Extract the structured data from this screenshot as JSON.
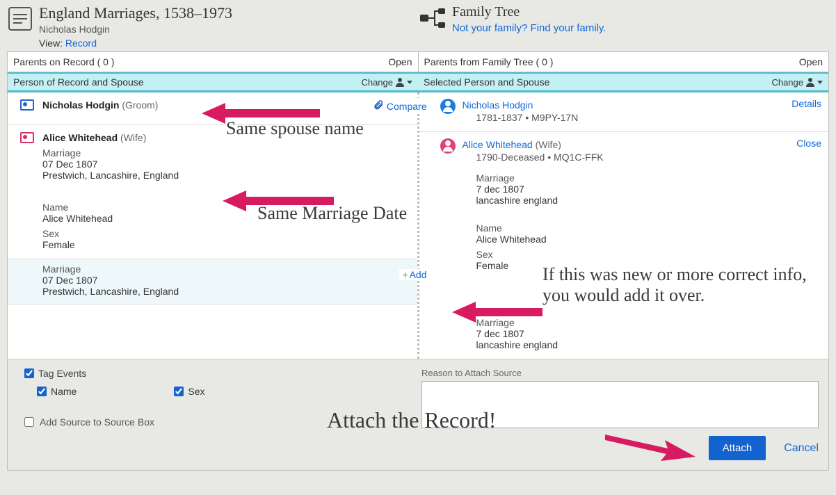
{
  "header": {
    "record_title": "England Marriages, 1538–1973",
    "record_person": "Nicholas Hodgin",
    "view_label": "View:",
    "view_link": "Record",
    "tree_title": "Family Tree",
    "tree_sub": "Not your family? Find your family."
  },
  "parents": {
    "left_label": "Parents on Record  ( 0 )",
    "right_label": "Parents from Family Tree  ( 0 )",
    "open": "Open"
  },
  "sections": {
    "left": "Person of Record and Spouse",
    "right": "Selected Person and Spouse",
    "change": "Change"
  },
  "left": {
    "person1_name": "Nicholas Hodgin",
    "person1_role": "(Groom)",
    "compare": "Compare",
    "person2_name": "Alice Whitehead",
    "person2_role": "(Wife)",
    "m_label": "Marriage",
    "m_date": "07 Dec 1807",
    "m_place": "Prestwich, Lancashire, England",
    "name_label": "Name",
    "name_val": "Alice Whitehead",
    "sex_label": "Sex",
    "sex_val": "Female",
    "add_m_label": "Marriage",
    "add_m_date": "07 Dec 1807",
    "add_m_place": "Prestwich, Lancashire, England",
    "add": "Add"
  },
  "right": {
    "person1_name": "Nicholas Hodgin",
    "person1_meta": "1781-1837 • M9PY-17N",
    "details": "Details",
    "person2_name": "Alice Whitehead",
    "person2_role": "(Wife)",
    "person2_meta": "1790-Deceased • MQ1C-FFK",
    "close": "Close",
    "m_label": "Marriage",
    "m_date": "7 dec 1807",
    "m_place": "lancashire england",
    "name_label": "Name",
    "name_val": "Alice Whitehead",
    "sex_label": "Sex",
    "sex_val": "Female",
    "m2_label": "Marriage",
    "m2_date": "7 dec 1807",
    "m2_place": "lancashire england"
  },
  "footer": {
    "tag_events": "Tag Events",
    "name_cb": "Name",
    "sex_cb": "Sex",
    "add_source": "Add Source to Source Box",
    "reason_label": "Reason to Attach Source",
    "attach": "Attach",
    "cancel": "Cancel"
  },
  "annotations": {
    "a1": "Same spouse name",
    "a2": "Same Marriage Date",
    "a3": "If this was new or more correct info, you would add it over.",
    "a4": "Attach the Record!"
  }
}
